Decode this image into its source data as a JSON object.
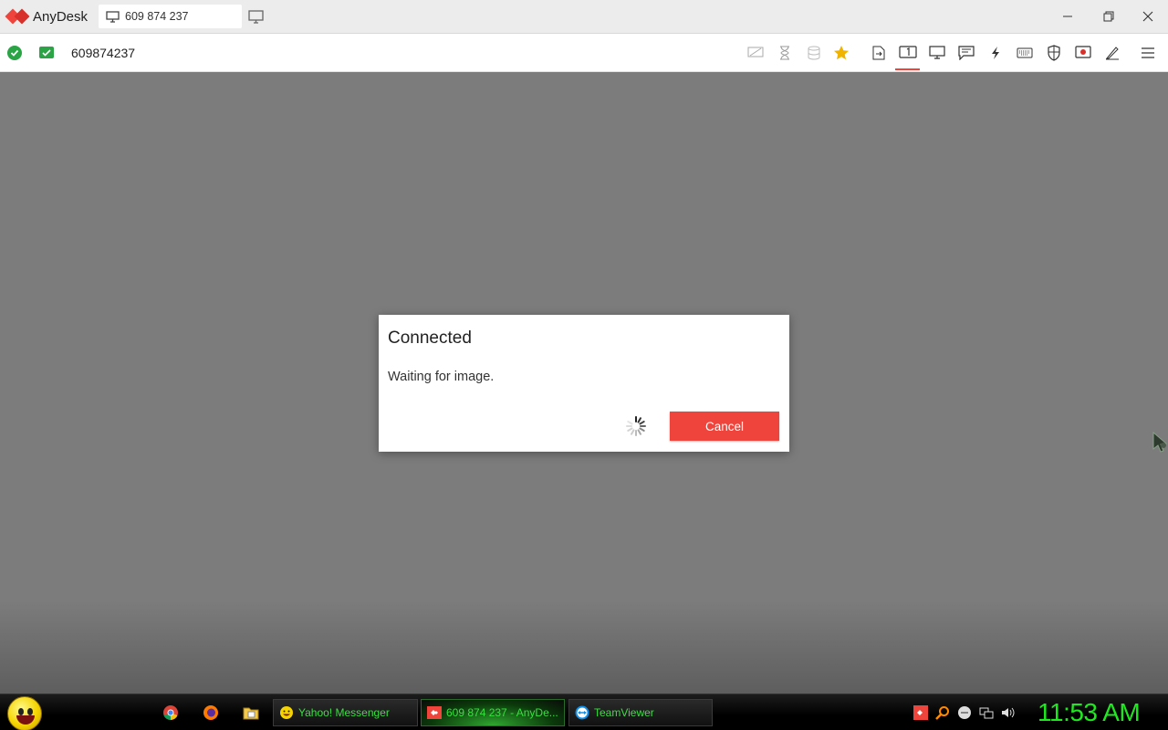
{
  "app": {
    "name": "AnyDesk"
  },
  "tabs": [
    {
      "label": "609 874 237"
    }
  ],
  "toolbar": {
    "address": "609874237"
  },
  "dialog": {
    "title": "Connected",
    "message": "Waiting for image.",
    "cancel_label": "Cancel"
  },
  "taskbar": {
    "windows": [
      {
        "label": "Yahoo! Messenger"
      },
      {
        "label": "609 874 237 - AnyDe..."
      },
      {
        "label": "TeamViewer"
      }
    ],
    "clock": "11:53 AM"
  },
  "colors": {
    "accent": "#ef443b",
    "status_green": "#2aa445",
    "clock_green": "#1ee81e"
  }
}
